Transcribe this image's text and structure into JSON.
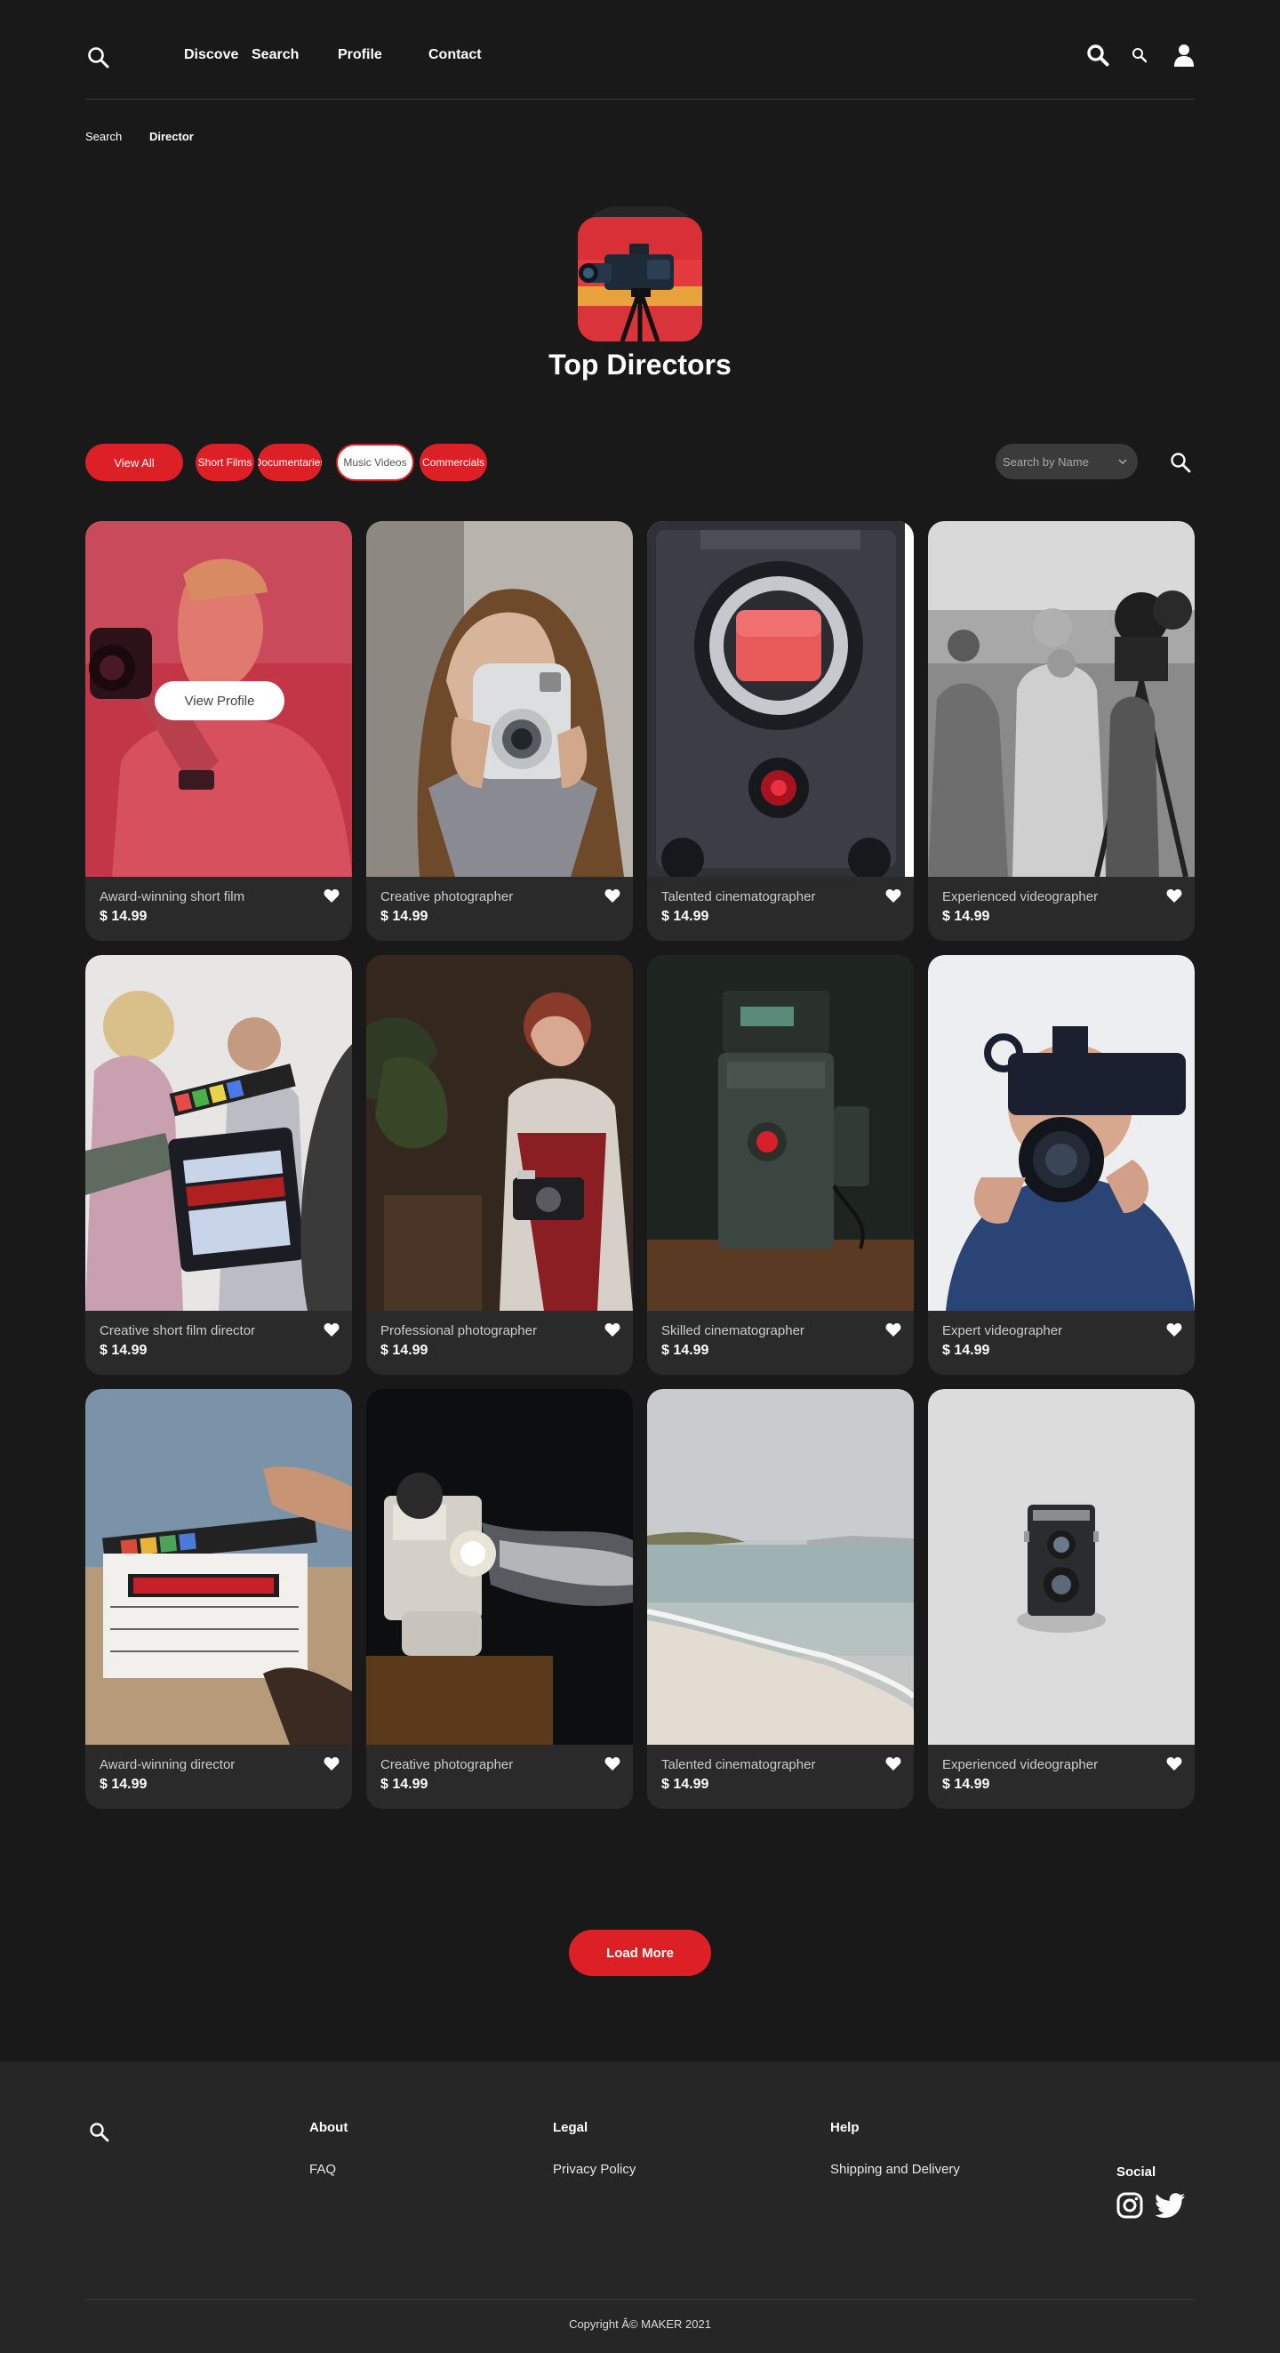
{
  "header": {
    "nav": [
      {
        "label": "Discove",
        "id": "discover"
      },
      {
        "label": "Search",
        "id": "search"
      },
      {
        "label": "Profile",
        "id": "profile"
      },
      {
        "label": "Contact",
        "id": "contact"
      }
    ]
  },
  "breadcrumb": {
    "items": [
      "Search",
      "Director"
    ]
  },
  "hero": {
    "title": "Top Directors"
  },
  "filters": {
    "chips": [
      "View All",
      "Short Films",
      "Documentaries",
      "Music Videos",
      "Commercials"
    ],
    "active": "Music Videos",
    "search_placeholder": "Search by Name"
  },
  "cards": [
    {
      "title": "Award-winning short film",
      "price": "$ 14.99",
      "hover_label": "View Profile",
      "image": "man-with-camera-red"
    },
    {
      "title": "Creative photographer",
      "price": "$ 14.99",
      "image": "girl-instant-camera"
    },
    {
      "title": "Talented cinematographer",
      "price": "$ 14.99",
      "image": "cinema-camera-sensor"
    },
    {
      "title": "Experienced videographer",
      "price": "$ 14.99",
      "image": "vintage-film-crew-bw"
    },
    {
      "title": "Creative short film director",
      "price": "$ 14.99",
      "image": "clapperboard-set"
    },
    {
      "title": "Professional photographer",
      "price": "$ 14.99",
      "image": "woman-film-camera"
    },
    {
      "title": "Skilled cinematographer",
      "price": "$ 14.99",
      "image": "red-camera-dark"
    },
    {
      "title": "Expert videographer",
      "price": "$ 14.99",
      "image": "man-sony-camcorder"
    },
    {
      "title": "Award-winning director",
      "price": "$ 14.99",
      "image": "clapperboard-beach"
    },
    {
      "title": "Creative photographer",
      "price": "$ 14.99",
      "image": "film-projector"
    },
    {
      "title": "Talented cinematographer",
      "price": "$ 14.99",
      "image": "beach-seascape"
    },
    {
      "title": "Experienced videographer",
      "price": "$ 14.99",
      "image": "twin-lens-camera"
    }
  ],
  "load_more": "Load More",
  "footer": {
    "columns": [
      {
        "heading": "About",
        "link": "FAQ"
      },
      {
        "heading": "Legal",
        "link": "Privacy Policy"
      },
      {
        "heading": "Help",
        "link": "Shipping and Delivery"
      }
    ],
    "social_heading": "Social",
    "copyright": "Copyright Â© MAKER 2021"
  },
  "colors": {
    "accent": "#dd1f26",
    "background": "#191919",
    "card": "#2a2a2a",
    "footer": "#262626"
  }
}
